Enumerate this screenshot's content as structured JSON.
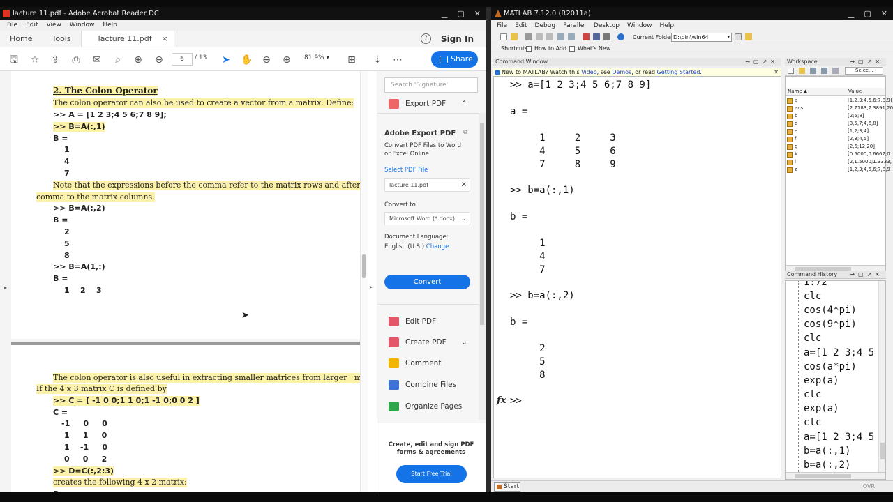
{
  "acrobat": {
    "window_title": "lacture 11.pdf - Adobe Acrobat Reader DC",
    "menu": [
      "File",
      "Edit",
      "View",
      "Window",
      "Help"
    ],
    "tabs": {
      "home": "Home",
      "tools": "Tools",
      "doc": "lacture 11.pdf",
      "close": "×"
    },
    "sign_in": "Sign In",
    "help": "?",
    "page_current": "6",
    "page_total": "/ 13",
    "zoom": "81.9%",
    "share": "Share",
    "page1": {
      "heading": "2. The Colon Operator",
      "lines": [
        "The colon operator can also be used to create a vector from a matrix. Define:",
        ">> A = [1 2 3;4 5 6;7 8 9];",
        ">> B=A(:,1)",
        "B =",
        "1",
        "4",
        "7",
        "Note that the expressions before the comma refer to the matrix rows and after the",
        "comma to the matrix columns.",
        ">> B=A(:,2)",
        "B =",
        "2",
        "5",
        "8",
        ">> B=A(1,:)",
        "B =",
        "1    2    3"
      ]
    },
    "page2": {
      "lines": [
        "The colon operator is also useful in extracting smaller matrices from larger   matrices.",
        "If the 4 x 3 matrix C is defined by",
        ">> C = [ -1 0 0;1 1 0;1 -1 0;0 0 2 ]",
        "C =",
        "-1     0     0",
        "1     1     0",
        "1    -1     0",
        "0     0     2",
        ">> D=C(:,2:3)",
        "creates the following 4 x 2 matrix:",
        "D ="
      ]
    },
    "panel": {
      "search_placeholder": "Search 'Signature'",
      "export_top": "Export PDF",
      "export_title": "Adobe Export PDF",
      "export_desc1": "Convert PDF Files to Word",
      "export_desc2": "or Excel Online",
      "select_file": "Select PDF File",
      "file_name": "lacture 11.pdf",
      "convert_to": "Convert to",
      "format": "Microsoft Word (*.docx)",
      "doc_lang": "Document Language:",
      "lang": "English (U.S.)",
      "change": "Change",
      "convert": "Convert",
      "tools": [
        "Edit PDF",
        "Create PDF",
        "Comment",
        "Combine Files",
        "Organize Pages"
      ],
      "promo1": "Create, edit and sign PDF",
      "promo2": "forms & agreements",
      "trial": "Start Free Trial"
    }
  },
  "matlab": {
    "window_title": "MATLAB  7.12.0 (R2011a)",
    "menu": [
      "File",
      "Edit",
      "Debug",
      "Parallel",
      "Desktop",
      "Window",
      "Help"
    ],
    "current_folder_label": "Current Folder:",
    "current_folder": "D:\\bin\\win64",
    "shortcuts": "Shortcuts",
    "how_to_add": "How to Add",
    "whats_new": "What's New",
    "cmd_title": "Command Window",
    "notice_pre": "New to MATLAB? Watch this ",
    "notice_video": "Video",
    "notice_mid": ", see ",
    "notice_demos": "Demos",
    "notice_mid2": ", or read ",
    "notice_gs": "Getting Started",
    "notice_end": ".",
    "cmd_lines": [
      ">> a=[1 2 3;4 5 6;7 8 9]",
      "a =",
      "     1     2     3",
      "     4     5     6",
      "     7     8     9",
      ">> b=a(:,1)",
      "b =",
      "     1",
      "     4",
      "     7",
      ">> b=a(:,2)",
      "b =",
      "     2",
      "     5",
      "     8",
      ">>"
    ],
    "fx": "fx",
    "ws_title": "Workspace",
    "ws_select": "Selec...",
    "ws_cols": {
      "name": "Name ▲",
      "value": "Value"
    },
    "ws_rows": [
      {
        "name": "a",
        "value": "[1,2,3;4,5,6;7,8,9]"
      },
      {
        "name": "ans",
        "value": "[2.7183,7.3891,20"
      },
      {
        "name": "b",
        "value": "[2;5;8]"
      },
      {
        "name": "d",
        "value": "[3,5,7;4,6,8]"
      },
      {
        "name": "e",
        "value": "[1,2;3,4]"
      },
      {
        "name": "f",
        "value": "[2,3;4,5]"
      },
      {
        "name": "g",
        "value": "[2,6;12,20]"
      },
      {
        "name": "k",
        "value": "[0.5000,0.6667;0."
      },
      {
        "name": "l",
        "value": "[2,1.5000;1.3333,"
      },
      {
        "name": "z",
        "value": "[1,2,3;4,5,6;7,8,9"
      }
    ],
    "hist_title": "Command History",
    "hist_lines": [
      "1:72",
      "clc",
      "cos(4*pi)",
      "cos(9*pi)",
      "clc",
      "a=[1 2 3;4 5",
      "cos(a*pi)",
      "exp(a)",
      "clc",
      "exp(a)",
      "clc",
      "a=[1 2 3;4 5",
      "b=a(:,1)",
      "b=a(:,2)"
    ],
    "start": "Start",
    "ovr": "OVR"
  }
}
